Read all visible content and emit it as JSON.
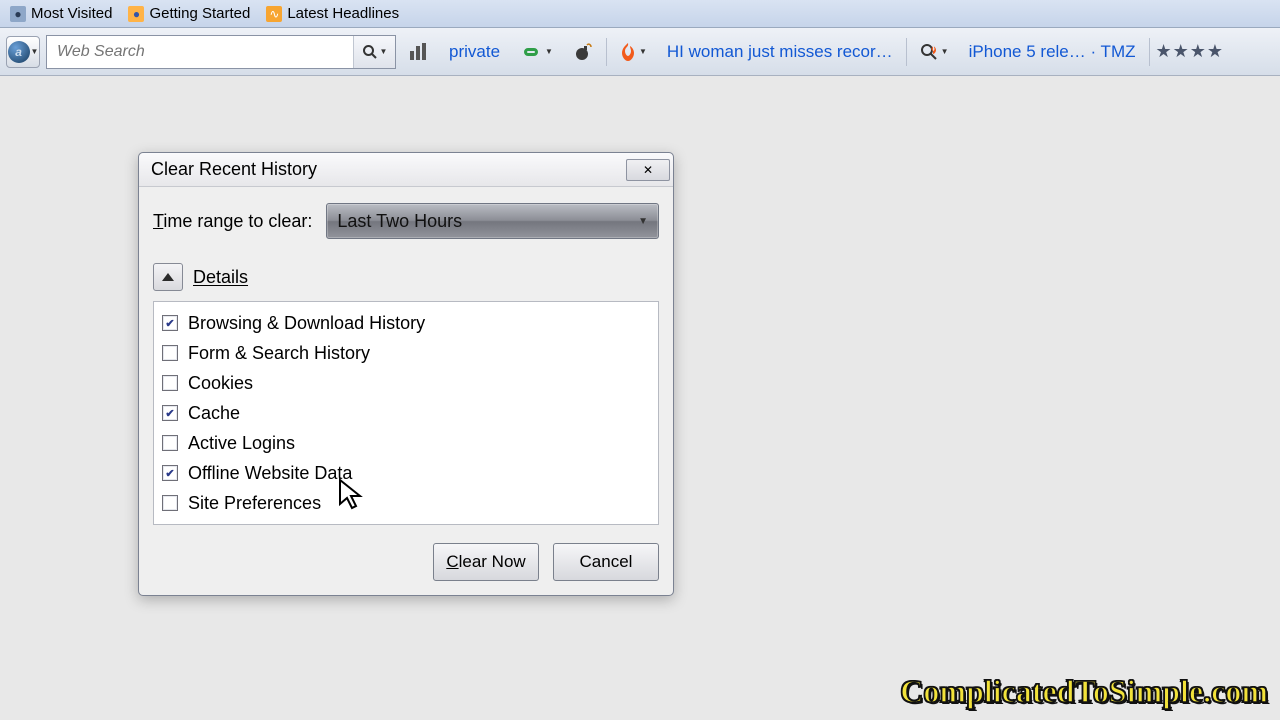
{
  "bookmarks": [
    {
      "label": "Most Visited",
      "icon": "page-icon",
      "icon_bg": "#8ea7c8",
      "icon_fg": "#2a3b55"
    },
    {
      "label": "Getting Started",
      "icon": "firefox-icon",
      "icon_bg": "#ffb347",
      "icon_fg": "#3455a9"
    },
    {
      "label": "Latest Headlines",
      "icon": "rss-icon",
      "icon_bg": "#f7a531",
      "icon_fg": "#fff"
    }
  ],
  "toolbar": {
    "search_placeholder": "Web Search",
    "private_label": "private",
    "news_items": [
      "HI woman just misses recor…",
      "iPhone 5 rele… · TMZ"
    ]
  },
  "dialog": {
    "title": "Clear Recent History",
    "range_label_pre": "T",
    "range_label_rest": "ime range to clear:",
    "range_value": "Last Two Hours",
    "details_label": "Details",
    "items": [
      {
        "label": "Browsing & Download History",
        "checked": true
      },
      {
        "label": "Form & Search History",
        "checked": false
      },
      {
        "label": "Cookies",
        "checked": false
      },
      {
        "label": "Cache",
        "checked": true
      },
      {
        "label": "Active Logins",
        "checked": false
      },
      {
        "label": "Offline Website Data",
        "checked": true
      },
      {
        "label": "Site Preferences",
        "checked": false
      }
    ],
    "clear_label": "Clear Now",
    "cancel_label": "Cancel"
  },
  "watermark": "ComplicatedToSimple.com"
}
